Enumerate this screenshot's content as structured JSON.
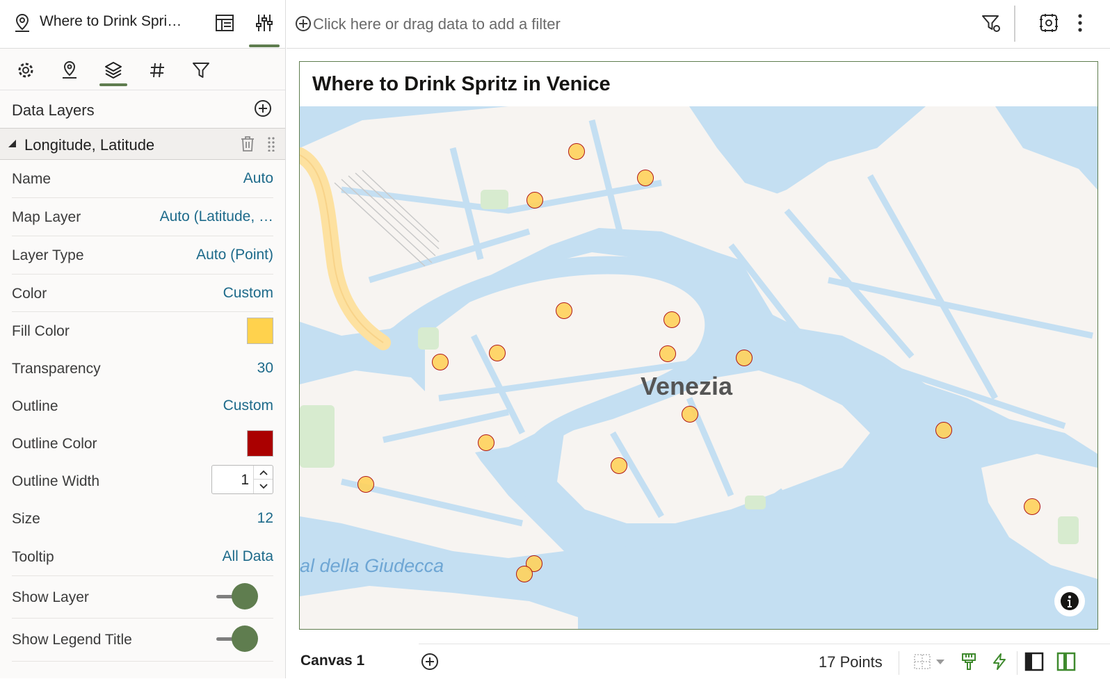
{
  "header": {
    "title": "Where to Drink Spri…",
    "filter_placeholder": "Click here or drag data to add a filter"
  },
  "left_panel": {
    "tabs": [
      {
        "name": "general",
        "icon": "gear-icon"
      },
      {
        "name": "map",
        "icon": "map-pin-icon"
      },
      {
        "name": "layers",
        "icon": "layers-icon",
        "active": true
      },
      {
        "name": "number-format",
        "icon": "hash-icon"
      },
      {
        "name": "filter",
        "icon": "filter-icon"
      }
    ],
    "data_layers_label": "Data Layers",
    "layer_title": "Longitude, Latitude",
    "properties": {
      "name": {
        "label": "Name",
        "value": "Auto"
      },
      "map_layer": {
        "label": "Map Layer",
        "value": "Auto (Latitude, …"
      },
      "layer_type": {
        "label": "Layer Type",
        "value": "Auto (Point)"
      },
      "color": {
        "label": "Color",
        "value": "Custom"
      },
      "fill_color": {
        "label": "Fill Color",
        "color": "#FFD24D"
      },
      "transparency": {
        "label": "Transparency",
        "value": "30"
      },
      "outline": {
        "label": "Outline",
        "value": "Custom"
      },
      "outline_color": {
        "label": "Outline Color",
        "color": "#AA0000"
      },
      "outline_width": {
        "label": "Outline Width",
        "value": "1"
      },
      "size": {
        "label": "Size",
        "value": "12"
      },
      "tooltip": {
        "label": "Tooltip",
        "value": "All Data"
      },
      "show_layer": {
        "label": "Show Layer",
        "on": true
      },
      "show_legend_title": {
        "label": "Show Legend Title",
        "on": true
      }
    }
  },
  "visualization": {
    "title": "Where to Drink Spritz in Venice",
    "map_labels": {
      "city": "Venezia",
      "canal": "al della Giudecca"
    },
    "points": [
      {
        "x": 0.347,
        "y": 0.086
      },
      {
        "x": 0.433,
        "y": 0.137
      },
      {
        "x": 0.295,
        "y": 0.18
      },
      {
        "x": 0.331,
        "y": 0.391
      },
      {
        "x": 0.466,
        "y": 0.408
      },
      {
        "x": 0.248,
        "y": 0.472
      },
      {
        "x": 0.176,
        "y": 0.49
      },
      {
        "x": 0.461,
        "y": 0.473
      },
      {
        "x": 0.557,
        "y": 0.482
      },
      {
        "x": 0.489,
        "y": 0.589
      },
      {
        "x": 0.807,
        "y": 0.62
      },
      {
        "x": 0.234,
        "y": 0.643
      },
      {
        "x": 0.4,
        "y": 0.687
      },
      {
        "x": 0.083,
        "y": 0.724
      },
      {
        "x": 0.918,
        "y": 0.766
      },
      {
        "x": 0.294,
        "y": 0.875
      },
      {
        "x": 0.282,
        "y": 0.895
      }
    ]
  },
  "bottom_bar": {
    "canvas_tab": "Canvas 1",
    "status": "17 Points"
  },
  "colors": {
    "accent": "#5F7D4F",
    "link": "#1D6A8A",
    "water": "#C4DFF2",
    "land": "#F7F4F1"
  }
}
